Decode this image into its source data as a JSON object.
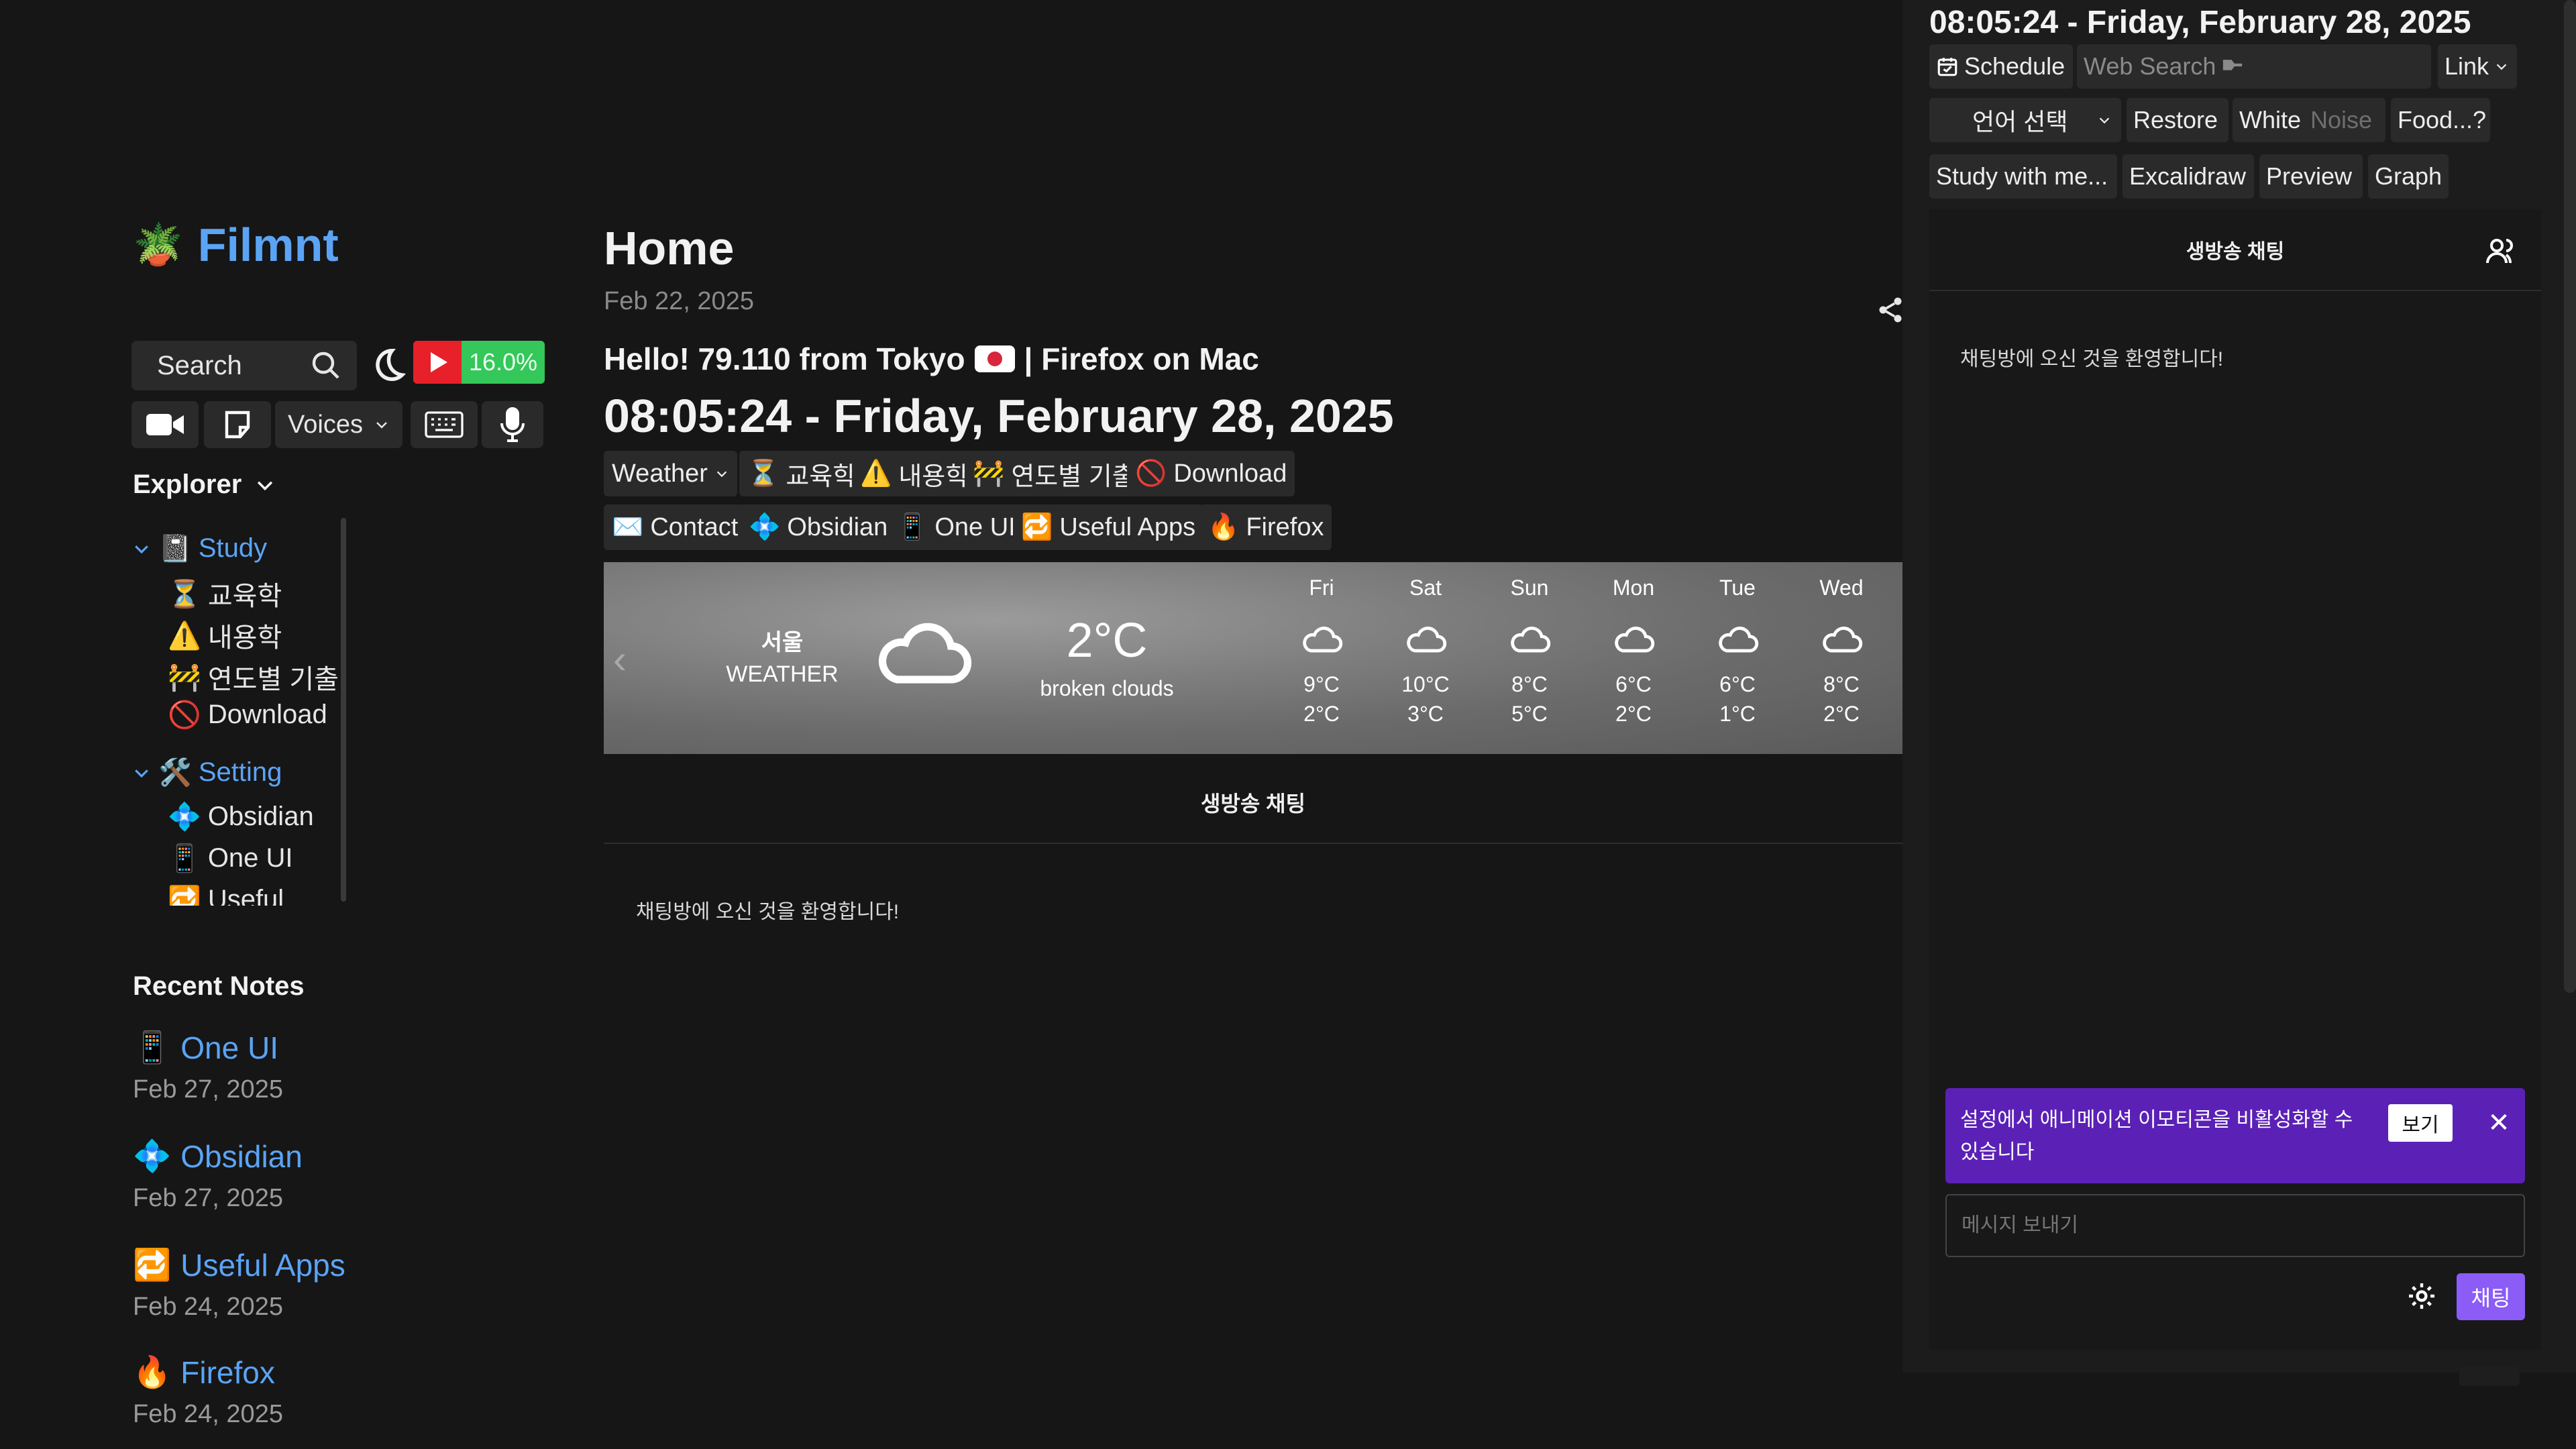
{
  "site": {
    "logo_emoji": "🪴",
    "name": "Filmnt"
  },
  "sidebar": {
    "search_label": "Search",
    "progress_percent": "16.0%",
    "voices_label": "Voices",
    "explorer_label": "Explorer",
    "tree": [
      {
        "type": "folder",
        "emoji": "📓",
        "label": "Study"
      },
      {
        "type": "leaf",
        "emoji": "⏳",
        "label": "교육학"
      },
      {
        "type": "leaf",
        "emoji": "⚠️",
        "label": "내용학"
      },
      {
        "type": "leaf",
        "emoji": "🚧",
        "label": "연도별 기출"
      },
      {
        "type": "leaf",
        "emoji": "🚫",
        "label": "Download"
      },
      {
        "type": "folder",
        "emoji": "🛠️",
        "label": "Setting"
      },
      {
        "type": "leaf",
        "emoji": "💠",
        "label": "Obsidian"
      },
      {
        "type": "leaf",
        "emoji": "📱",
        "label": "One UI"
      },
      {
        "type": "leaf",
        "emoji": "🔁",
        "label": "Useful"
      }
    ],
    "recent_title": "Recent Notes",
    "recent": [
      {
        "emoji": "📱",
        "title": "One UI",
        "date": "Feb 27, 2025"
      },
      {
        "emoji": "💠",
        "title": "Obsidian",
        "date": "Feb 27, 2025"
      },
      {
        "emoji": "🔁",
        "title": "Useful Apps",
        "date": "Feb 24, 2025"
      },
      {
        "emoji": "🔥",
        "title": "Firefox",
        "date": "Feb 24, 2025"
      }
    ]
  },
  "main": {
    "title": "Home",
    "date": "Feb 22, 2025",
    "hello": "Hello! 79.110 from Tokyo",
    "browser": "| Firefox on Mac",
    "clock": "08:05:24 - Friday, February 28, 2025",
    "chips_row1": [
      {
        "emoji": "",
        "label": "Weather",
        "dropdown": true
      },
      {
        "emoji": "⏳",
        "label": "교육학"
      },
      {
        "emoji": "⚠️",
        "label": "내용학"
      },
      {
        "emoji": "🚧",
        "label": "연도별 기출"
      },
      {
        "emoji": "🚫",
        "label": "Download"
      }
    ],
    "chips_row2": [
      {
        "emoji": "✉️",
        "label": "Contact"
      },
      {
        "emoji": "💠",
        "label": "Obsidian"
      },
      {
        "emoji": "📱",
        "label": "One UI"
      },
      {
        "emoji": "🔁",
        "label": "Useful Apps"
      },
      {
        "emoji": "🔥",
        "label": "Firefox"
      }
    ],
    "weather": {
      "city": "서울",
      "label": "WEATHER",
      "temp": "2°C",
      "desc": "broken clouds",
      "forecast": [
        {
          "day": "Fri",
          "hi": "9°C",
          "lo": "2°C"
        },
        {
          "day": "Sat",
          "hi": "10°C",
          "lo": "3°C"
        },
        {
          "day": "Sun",
          "hi": "8°C",
          "lo": "5°C"
        },
        {
          "day": "Mon",
          "hi": "6°C",
          "lo": "2°C"
        },
        {
          "day": "Tue",
          "hi": "6°C",
          "lo": "1°C"
        },
        {
          "day": "Wed",
          "hi": "8°C",
          "lo": "2°C"
        }
      ]
    },
    "chat_title": "생방송 채팅",
    "chat_welcome": "채팅방에 오신 것을 환영합니다!"
  },
  "panel": {
    "clock": "08:05:24 - Friday, February 28, 2025",
    "schedule": "Schedule",
    "search_placeholder": "Web Search",
    "link": "Link",
    "language": "언어 선택",
    "restore": "Restore",
    "white": "White",
    "noise": "Noise",
    "food": "Food...?",
    "study": "Study with me...",
    "excalidraw": "Excalidraw",
    "preview": "Preview",
    "graph": "Graph",
    "chat_title": "생방송 채팅",
    "chat_welcome": "채팅방에 오신 것을 환영합니다!",
    "notice": "설정에서 애니메이션 이모티콘을 비활성화할 수 있습니다",
    "notice_button": "보기",
    "input_placeholder": "메시지 보내기",
    "send": "채팅"
  }
}
